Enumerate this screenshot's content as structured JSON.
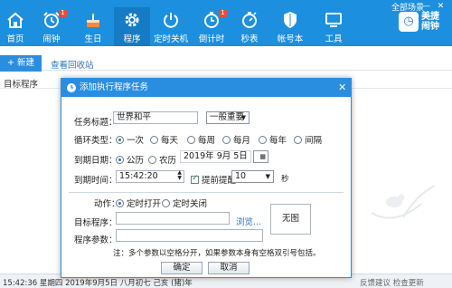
{
  "window": {
    "scene_label": "全部场景",
    "min": "—",
    "close": "✕"
  },
  "nav": [
    {
      "label": "首页",
      "icon": "home-icon",
      "badge": ""
    },
    {
      "label": "闹钟",
      "icon": "alarm-clock-icon",
      "badge": "1"
    },
    {
      "label": "生日",
      "icon": "cake-icon",
      "badge": ""
    },
    {
      "label": "程序",
      "icon": "gear-icon",
      "badge": "",
      "active": true
    },
    {
      "label": "定时关机",
      "icon": "power-icon",
      "badge": ""
    },
    {
      "label": "倒计时",
      "icon": "countdown-clock-icon",
      "badge": "1"
    },
    {
      "label": "秒表",
      "icon": "stopwatch-icon",
      "badge": ""
    },
    {
      "label": "帐号本",
      "icon": "shield-icon",
      "badge": ""
    },
    {
      "label": "工具",
      "icon": "monitor-icon",
      "badge": ""
    }
  ],
  "brand": {
    "line1": "美捷",
    "line2": "闹钟"
  },
  "toolbar": {
    "new_label": "+ 新建",
    "recycle_label": "查看回收站"
  },
  "list": {
    "column_header": "目标程序"
  },
  "status": {
    "left": "15:42:36 星期四  2019年9月5日 八月初七 己亥 (猪)年",
    "right": "反馈建议  检查更新"
  },
  "dialog": {
    "title": "添加执行程序任务",
    "close": "✕",
    "task_title_label": "任务标题：",
    "task_title_value": "世界和平",
    "priority_value": "一般重要",
    "cycle_label": "循环类型：",
    "cycle_options": [
      "一次",
      "每天",
      "每周",
      "每月",
      "每年",
      "间隔"
    ],
    "cycle_selected": 0,
    "date_label": "到期日期：",
    "calendar_options": [
      "公历",
      "农历"
    ],
    "calendar_selected": 0,
    "date_value": "2019年  9月  5日",
    "time_label": "到期时间：",
    "time_value": "15:42:20",
    "remind_label": "提前提醒",
    "remind_checked": true,
    "remind_value": "10",
    "remind_unit": "秒",
    "action_label": "动作：",
    "action_options": [
      "定时打开",
      "定时关闭"
    ],
    "action_selected": 0,
    "target_label": "目标程序：",
    "target_value": "",
    "browse_label": "浏览...",
    "params_label": "程序参数：",
    "params_value": "",
    "no_image_label": "无图",
    "note": "注：多个参数以空格分开，如果参数本身有空格双引号包括。",
    "ok_label": "确定",
    "cancel_label": "取消"
  },
  "colors": {
    "accent": "#1c8fdf",
    "dialog_title": "#2a8ee0",
    "badge": "#e74c3c"
  }
}
